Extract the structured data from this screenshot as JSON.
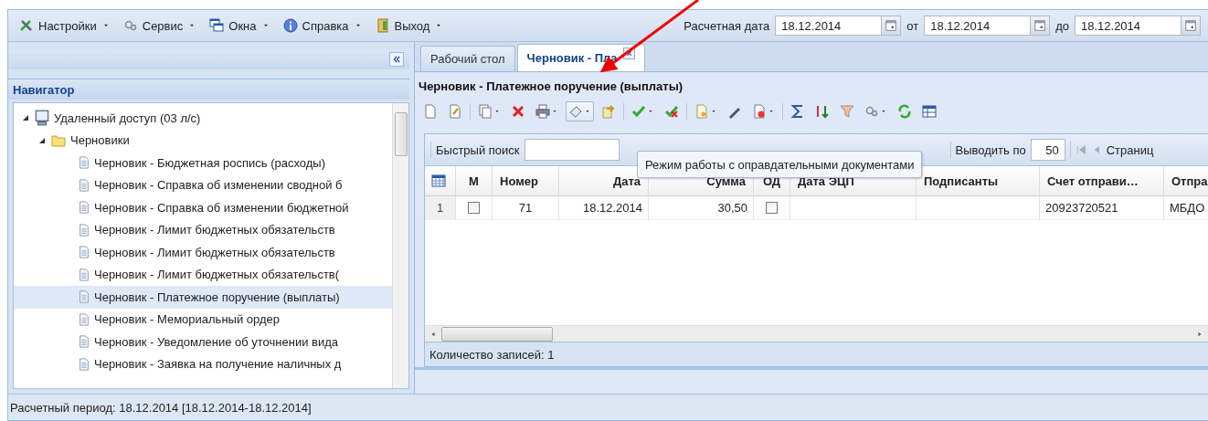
{
  "menu": [
    {
      "label": "Настройки"
    },
    {
      "label": "Сервис"
    },
    {
      "label": "Окна"
    },
    {
      "label": "Справка"
    },
    {
      "label": "Выход"
    }
  ],
  "dates": [
    {
      "label": "Расчетная дата",
      "value": "18.12.2014"
    },
    {
      "label": "от",
      "value": "18.12.2014"
    },
    {
      "label": "до",
      "value": "18.12.2014"
    }
  ],
  "navigator": {
    "title": "Навигатор",
    "tree": [
      {
        "label": "Удаленный доступ (03 л/с)",
        "kind": "computer",
        "expanded": true,
        "children": [
          {
            "label": "Черновики",
            "kind": "folder",
            "expanded": true,
            "children": [
              {
                "label": "Черновик - Бюджетная роспись (расходы)",
                "kind": "doc",
                "selected": false
              },
              {
                "label": "Черновик - Справка об изменении сводной б",
                "kind": "doc",
                "selected": false
              },
              {
                "label": "Черновик - Справка об изменении бюджетной",
                "kind": "doc",
                "selected": false
              },
              {
                "label": "Черновик - Лимит бюджетных обязательств",
                "kind": "doc",
                "selected": false
              },
              {
                "label": "Черновик - Лимит бюджетных обязательств",
                "kind": "doc",
                "selected": false
              },
              {
                "label": "Черновик - Лимит бюджетных обязательств(",
                "kind": "doc",
                "selected": false
              },
              {
                "label": "Черновик - Платежное поручение (выплаты)",
                "kind": "doc",
                "selected": true
              },
              {
                "label": "Черновик - Мемориальный ордер",
                "kind": "doc",
                "selected": false
              },
              {
                "label": "Черновик - Уведомление об уточнении вида",
                "kind": "doc",
                "selected": false
              },
              {
                "label": "Черновик - Заявка на получение наличных д",
                "kind": "doc",
                "selected": false
              }
            ]
          }
        ]
      }
    ]
  },
  "tabs": [
    {
      "label": "Рабочий стол",
      "selected": false,
      "closable": false
    },
    {
      "label": "Черновик - Пла",
      "selected": true,
      "closable": true
    }
  ],
  "document": {
    "title": "Черновик - Платежное поручение (выплаты)",
    "quick_search": {
      "label": "Быстрый поиск"
    },
    "tooltip": "Режим работы с оправдательными документами",
    "page_size": {
      "label": "Выводить по",
      "value": "50"
    },
    "page_label": "Страниц",
    "columns": [
      "М",
      "Номер",
      "Дата",
      "Сумма",
      "ОД",
      "Дата ЭЦП",
      "Подписанты",
      "Счет отправи…",
      "Отпра"
    ],
    "rows": [
      {
        "number": "1",
        "cells": [
          {
            "kind": "checkbox",
            "checked": false
          },
          {
            "kind": "text",
            "text": "71"
          },
          {
            "kind": "text",
            "text": "18.12.2014"
          },
          {
            "kind": "text",
            "text": "30,50"
          },
          {
            "kind": "checkbox",
            "checked": false
          },
          {
            "kind": "empty"
          },
          {
            "kind": "empty"
          },
          {
            "kind": "text",
            "text": "20923720521"
          },
          {
            "kind": "text",
            "text": "МБДО"
          }
        ]
      }
    ],
    "record_count": "Количество записей: 1"
  },
  "status_bar": "Расчетный период: 18.12.2014 [18.12.2014-18.12.2014]"
}
